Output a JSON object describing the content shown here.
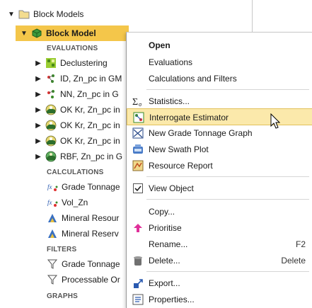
{
  "tree": {
    "root": "Block Models",
    "selected": "Block Model",
    "items": [
      {
        "kind": "section",
        "label": "EVALUATIONS"
      },
      {
        "kind": "item",
        "label": "Declustering",
        "icon": "declustering-icon"
      },
      {
        "kind": "item",
        "label": "ID, Zn_pc in GM",
        "icon": "id-estimator-icon"
      },
      {
        "kind": "item",
        "label": "NN, Zn_pc in G",
        "icon": "nn-estimator-icon"
      },
      {
        "kind": "item",
        "label": "OK Kr, Zn_pc in",
        "icon": "kriging-icon"
      },
      {
        "kind": "item",
        "label": "OK Kr, Zn_pc in",
        "icon": "kriging-icon"
      },
      {
        "kind": "item",
        "label": "OK Kr, Zn_pc in",
        "icon": "kriging-icon"
      },
      {
        "kind": "item",
        "label": "RBF, Zn_pc in G",
        "icon": "rbf-icon"
      },
      {
        "kind": "section",
        "label": "CALCULATIONS"
      },
      {
        "kind": "item",
        "label": "Grade Tonnage",
        "icon": "calculation-icon"
      },
      {
        "kind": "item",
        "label": "Vol_Zn",
        "icon": "calculation-icon"
      },
      {
        "kind": "item",
        "label": "Mineral Resour",
        "icon": "category-icon"
      },
      {
        "kind": "item",
        "label": "Mineral Reserv",
        "icon": "category-icon"
      },
      {
        "kind": "section",
        "label": "FILTERS"
      },
      {
        "kind": "item",
        "label": "Grade Tonnage",
        "icon": "filter-icon"
      },
      {
        "kind": "item",
        "label": "Processable Or",
        "icon": "filter-icon"
      },
      {
        "kind": "section",
        "label": "GRAPHS"
      }
    ]
  },
  "menu": {
    "items": [
      {
        "label": "Open",
        "shortcut": ""
      },
      {
        "label": "Evaluations",
        "shortcut": ""
      },
      {
        "label": "Calculations and Filters",
        "shortcut": ""
      },
      {
        "label": "Statistics...",
        "shortcut": ""
      },
      {
        "label": "Interrogate Estimator",
        "shortcut": ""
      },
      {
        "label": "New Grade Tonnage Graph",
        "shortcut": ""
      },
      {
        "label": "New Swath Plot",
        "shortcut": ""
      },
      {
        "label": "Resource Report",
        "shortcut": ""
      },
      {
        "label": "View Object",
        "shortcut": ""
      },
      {
        "label": "Copy...",
        "shortcut": ""
      },
      {
        "label": "Prioritise",
        "shortcut": ""
      },
      {
        "label": "Rename...",
        "shortcut": "F2"
      },
      {
        "label": "Delete...",
        "shortcut": "Delete"
      },
      {
        "label": "Export...",
        "shortcut": ""
      },
      {
        "label": "Properties...",
        "shortcut": ""
      }
    ],
    "highlighted": "Interrogate Estimator",
    "view_object_checked": true
  },
  "colors": {
    "selection": "#f4c64a",
    "hover": "#fbe9ab",
    "prioritise_arrow": "#e0309a",
    "folder": "#e8c668"
  }
}
